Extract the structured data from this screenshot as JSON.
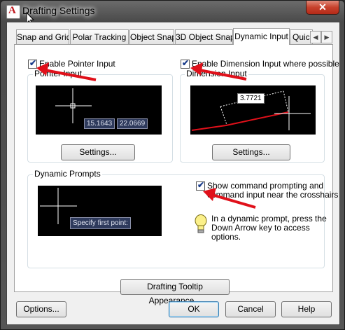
{
  "window": {
    "title": "Drafting Settings",
    "close_glyph": "✕",
    "app_icon_glyph": "A"
  },
  "tabs": [
    {
      "label": "Snap and Grid"
    },
    {
      "label": "Polar Tracking"
    },
    {
      "label": "Object Snap"
    },
    {
      "label": "3D Object Snap"
    },
    {
      "label": "Dynamic Input",
      "active": true
    },
    {
      "label": "Quick"
    }
  ],
  "tab_scroll": {
    "left": "◀",
    "right": "▶"
  },
  "pointer": {
    "checkbox_label": "Enable Pointer Input",
    "checked": true,
    "group_label": "Pointer Input",
    "preview_x": "15.1643",
    "preview_y": "22.0669",
    "settings_label": "Settings..."
  },
  "dimension": {
    "checkbox_label": "Enable Dimension Input where possible",
    "checked": true,
    "group_label": "Dimension Input",
    "preview_value": "3.7721",
    "settings_label": "Settings..."
  },
  "prompts": {
    "group_label": "Dynamic Prompts",
    "preview_text": "Specify first point:",
    "checkbox_label_line1": "Show command prompting and",
    "checkbox_label_line2": "command input near the crosshairs",
    "checked": true,
    "tip_line1": "In a dynamic prompt, press the",
    "tip_line2": "Down Arrow key to access",
    "tip_line3": "options."
  },
  "tooltip_button_label": "Drafting Tooltip Appearance...",
  "footer": {
    "options_label": "Options...",
    "ok_label": "OK",
    "cancel_label": "Cancel",
    "help_label": "Help"
  },
  "check_glyph": "✔",
  "icons": [
    "app-icon",
    "close-icon",
    "lightbulb-icon",
    "cursor-icon",
    "red-arrow-annotation"
  ],
  "colors": {
    "annotation_arrow": "#e0101a",
    "preview_bg": "#000000",
    "tooltip_bg": "#2e3a5c"
  }
}
